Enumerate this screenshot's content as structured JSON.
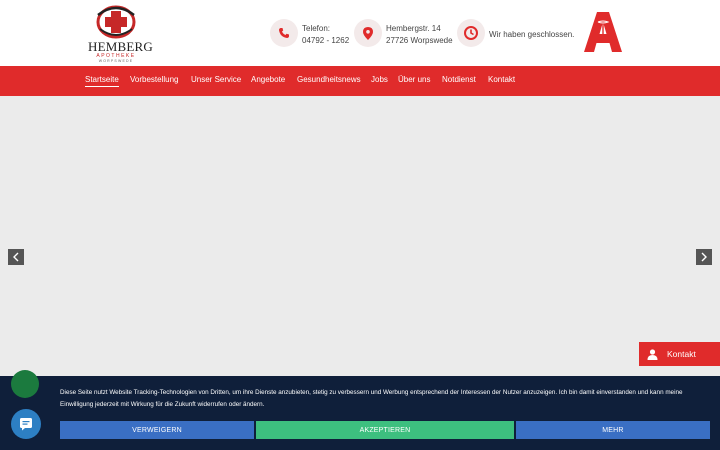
{
  "logo": {
    "name": "HEMBERG",
    "sub": "APOTHEKE",
    "sub2": "WORPSWEDE"
  },
  "header": {
    "phone": {
      "label": "Telefon:",
      "value": "04792 - 1262"
    },
    "address": {
      "street": "Hembergstr. 14",
      "city": "27726 Worpswede"
    },
    "status": "Wir haben geschlossen."
  },
  "nav": {
    "items": [
      "Startseite",
      "Vorbestellung",
      "Unser Service",
      "Angebote",
      "Gesundheitsnews",
      "Jobs",
      "Über uns",
      "Notdienst",
      "Kontakt"
    ],
    "active_index": 0
  },
  "contact_tab": {
    "label": "Kontakt"
  },
  "cookie": {
    "text": "Diese Seite nutzt Website Tracking-Technologien von Dritten, um ihre Dienste anzubieten, stetig zu verbessern und Werbung entsprechend der Interessen der Nutzer anzuzeigen. Ich bin damit einverstanden und kann meine Einwilligung jederzeit mit Wirkung für die Zukunft widerrufen oder ändern.",
    "decline": "VERWEIGERN",
    "accept": "AKZEPTIEREN",
    "more": "MEHR"
  },
  "colors": {
    "brand_red": "#e02b2b",
    "banner_bg": "#0f1f3a",
    "btn_blue": "#3a6fc4",
    "btn_green": "#3dbf7f"
  },
  "icons": [
    "phone-icon",
    "location-icon",
    "clock-icon",
    "pharmacy-a-logo",
    "chevron-left-icon",
    "chevron-right-icon",
    "person-icon",
    "chat-icon"
  ]
}
